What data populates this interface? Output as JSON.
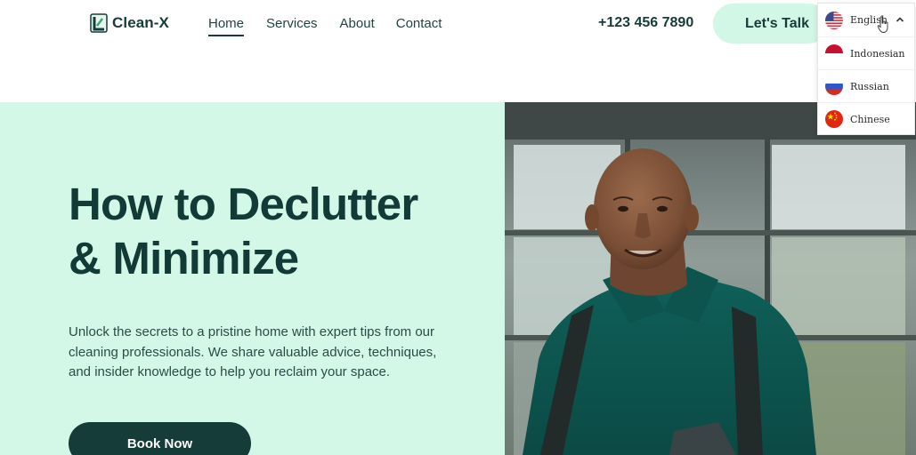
{
  "brand": {
    "name": "Clean-X",
    "color": "#153c38"
  },
  "nav": {
    "items": [
      {
        "label": "Home",
        "active": true
      },
      {
        "label": "Services",
        "active": false
      },
      {
        "label": "About",
        "active": false
      },
      {
        "label": "Contact",
        "active": false
      }
    ]
  },
  "header": {
    "phone": "+123 456 7890",
    "cta_label": "Let's Talk"
  },
  "language_menu": {
    "selected": "English",
    "expanded": true,
    "options": [
      {
        "label": "English",
        "flag": "us-flag-icon"
      },
      {
        "label": "Indonesian",
        "flag": "indonesia-flag-icon"
      },
      {
        "label": "Russian",
        "flag": "russia-flag-icon"
      },
      {
        "label": "Chinese",
        "flag": "china-flag-icon"
      }
    ]
  },
  "hero": {
    "title_line1": "How to Declutter",
    "title_line2": "& Minimize",
    "description": "Unlock the secrets to a pristine home with expert tips from our cleaning professionals. We share valuable advice, techniques, and insider knowledge to help you reclaim your space.",
    "button_label": "Book Now",
    "background_color": "#d3f8e8",
    "image": "smiling-cleaner-photo"
  }
}
